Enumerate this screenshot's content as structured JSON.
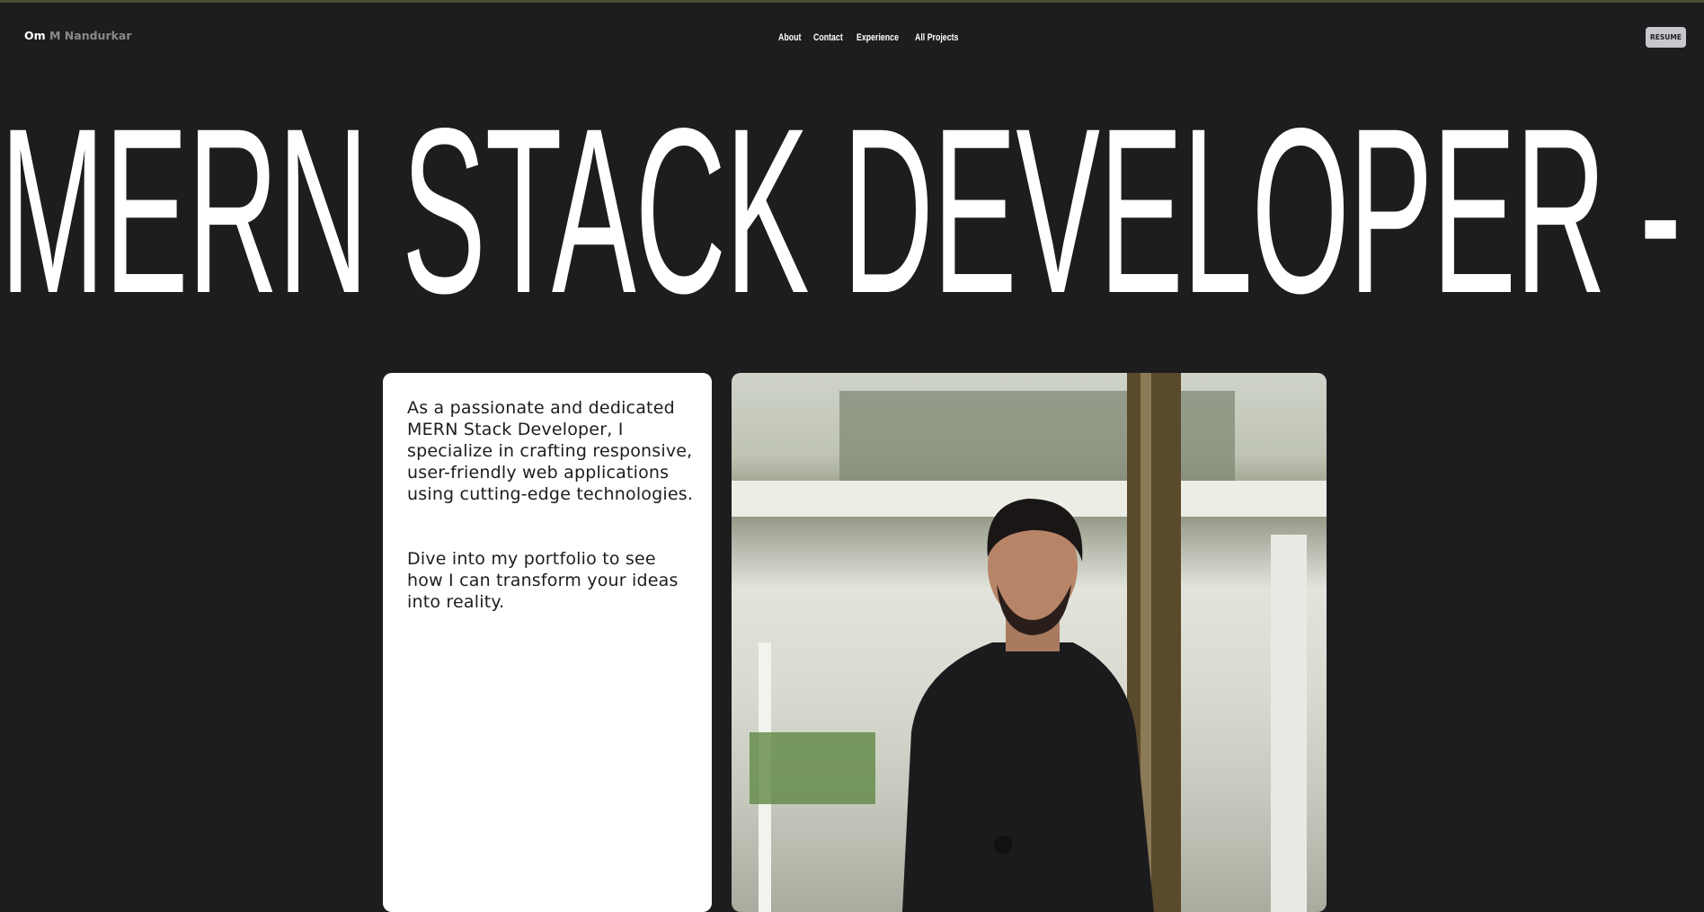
{
  "header": {
    "logo_first": "Om",
    "logo_rest": "M Nandurkar",
    "nav": [
      "About",
      "Contact",
      "Experience",
      "All Projects"
    ],
    "resume_label": "RESUME"
  },
  "hero": {
    "headline": "MERN STACK DEVELOPER -"
  },
  "intro": {
    "paragraph1": "As a passionate and dedicated MERN Stack Developer, I specialize in crafting responsive, user-friendly web applications using cutting-edge technologies.",
    "paragraph2": "Dive into my portfolio to see how I can transform your ideas into reality."
  },
  "colors": {
    "background": "#1d1d1f",
    "card": "#ffffff",
    "resume_button": "#c5c7cc"
  }
}
